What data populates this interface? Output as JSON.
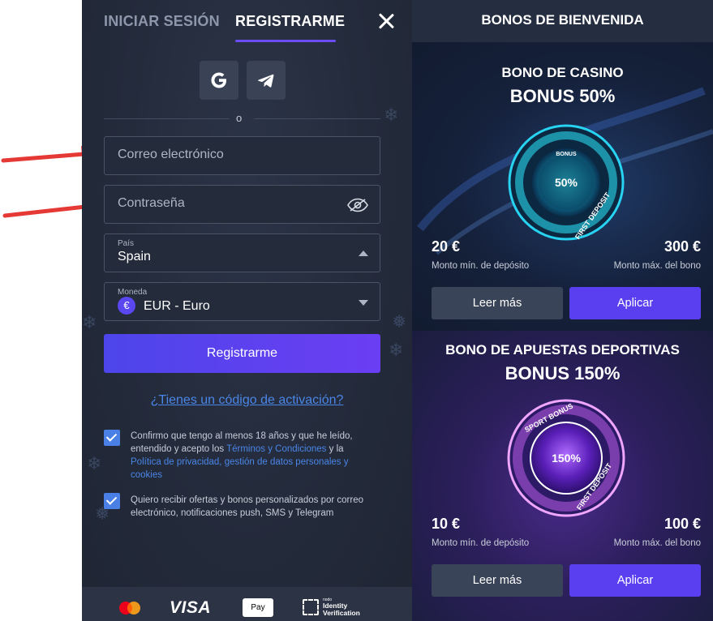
{
  "register_panel": {
    "tabs": [
      {
        "label": "INICIAR SESIÓN",
        "active": false
      },
      {
        "label": "REGISTRARME",
        "active": true
      }
    ],
    "divider_text": "o",
    "email_placeholder": "Correo electrónico",
    "password_placeholder": "Contraseña",
    "country": {
      "label": "País",
      "value": "Spain"
    },
    "currency": {
      "label": "Moneda",
      "symbol": "€",
      "value": "EUR - Euro"
    },
    "register_button": "Registrarme",
    "activation_link": "¿Tienes un código de activación?",
    "consent": {
      "age_text_1": "Confirmo que tengo al menos 18 años y que he leído, entendido y acepto los ",
      "terms_link": "Términos y Condiciones",
      "age_text_2": " y la ",
      "privacy_link": "Política de privacidad, gestión de datos personales y cookies",
      "age_checked": true,
      "offers_text": "Quiero recibir ofertas y bonos personalizados por correo electrónico, notificaciones push, SMS y Telegram",
      "offers_checked": true
    },
    "payments": {
      "visa": "VISA",
      "applepay": "Pay",
      "identity_small": "nodo",
      "identity_line1": "Identity",
      "identity_line2": "Verification"
    }
  },
  "bonus_panel": {
    "title": "BONOS DE BIENVENIDA",
    "bonuses": [
      {
        "type": "BONO DE CASINO",
        "percent_label": "BONUS 50%",
        "badge_percent": "50%",
        "badge_top": "BONUS",
        "badge_ring": "FIRST DEPOSIT",
        "min_amount": "20 €",
        "min_label": "Monto mín. de depósito",
        "max_amount": "300 €",
        "max_label": "Monto máx. del bono",
        "more_button": "Leer más",
        "apply_button": "Aplicar"
      },
      {
        "type": "BONO DE APUESTAS DEPORTIVAS",
        "percent_label": "BONUS 150%",
        "badge_percent": "150%",
        "badge_top": "SPORT BONUS",
        "badge_ring": "FIRST DEPOSIT",
        "min_amount": "10 €",
        "min_label": "Monto mín. de depósito",
        "max_amount": "100 €",
        "max_label": "Monto máx. del bono",
        "more_button": "Leer más",
        "apply_button": "Aplicar"
      }
    ]
  },
  "colors": {
    "panel_bg": "#232a3a",
    "accent": "#5a3ff0",
    "link": "#4a86e8",
    "arrow": "#e53935"
  }
}
